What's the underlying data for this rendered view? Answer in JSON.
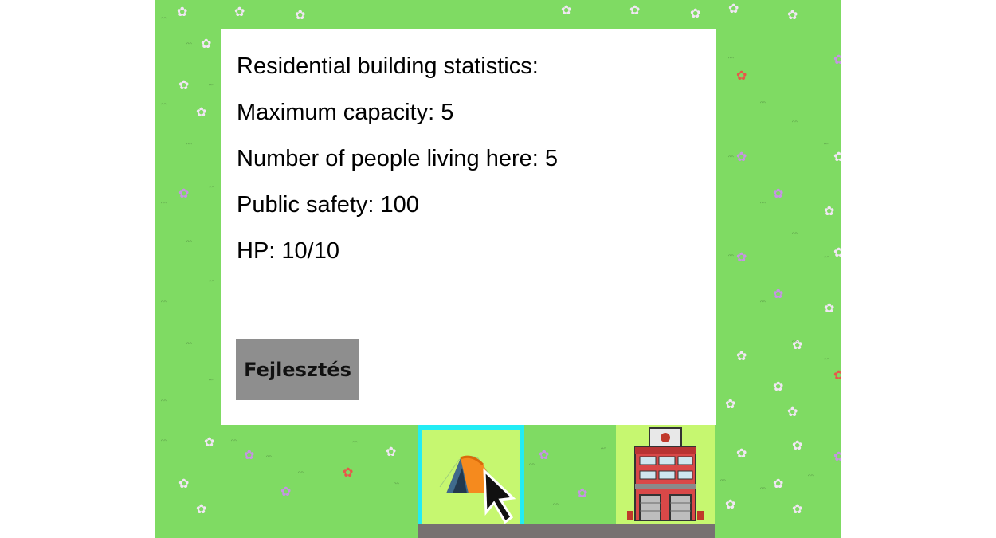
{
  "stats_panel": {
    "title": "Residential building statistics:",
    "max_capacity": "Maximum capacity: 5",
    "residents": "Number of people living here: 5",
    "public_safety": "Public safety: 100",
    "hp": "HP: 10/10",
    "upgrade_button": "Fejlesztés"
  },
  "tiles": [
    {
      "building": "tent",
      "icon": "tent-icon",
      "selected": true
    },
    {
      "building": "fire-station",
      "icon": "fire-station-icon",
      "selected": false
    }
  ],
  "colors": {
    "grass": "#7fdb63",
    "tile": "#c6f770",
    "selection": "#22ecf4",
    "road": "#777171",
    "button": "#8e8e8e"
  }
}
